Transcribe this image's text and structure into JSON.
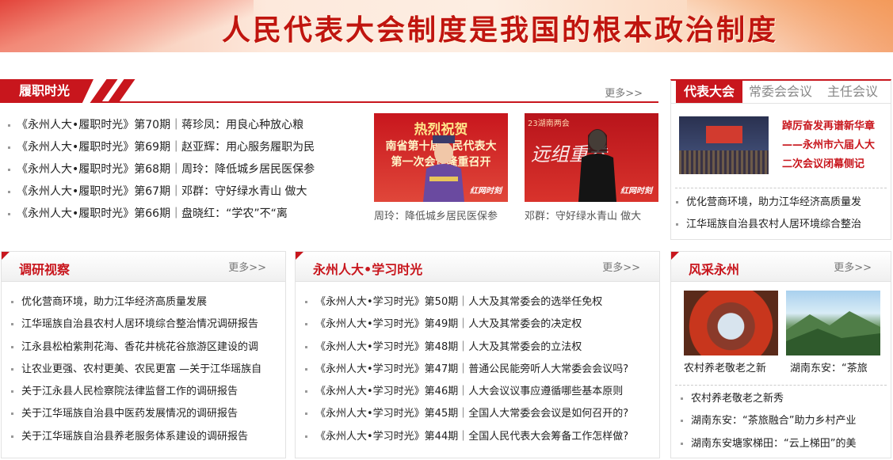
{
  "banner": {
    "title": "人民代表大会制度是我国的根本政治制度"
  },
  "lvzhi": {
    "title": "履职时光",
    "more": "更多>>",
    "items": [
      "《永州人大•履职时光》第70期｜蒋珍凤：用良心种放心粮",
      "《永州人大•履职时光》第69期｜赵亚辉：用心服务履职为民",
      "《永州人大•履职时光》第68期｜周玲：降低城乡居民医保参",
      "《永州人大•履职时光》第67期｜邓群：守好绿水青山 做大",
      "《永州人大•履职时光》第66期｜盘晓红：“学农”不“离"
    ],
    "photos": [
      {
        "caption": "周玲：降低城乡居民医保参",
        "overlay1": "热烈祝贺",
        "overlay2": "南省第十届人民代表大",
        "overlay3": "第一次会议隆重召开",
        "stamp": "红网时刻"
      },
      {
        "caption": "邓群：守好绿水青山 做大",
        "overlay1": "23湖南两会",
        "overlay2": "远组重卷",
        "stamp": "红网时刻"
      }
    ]
  },
  "daibiao": {
    "tabs": [
      "代表大会",
      "常委会会议",
      "主任会议"
    ],
    "feature_title": "踔厉奋发再谱新华章——永州市六届人大二次会议闭幕侧记",
    "items": [
      "优化营商环境，助力江华经济高质量发",
      "江华瑶族自治县农村人居环境综合整治"
    ]
  },
  "diaoyan": {
    "title": "调研视察",
    "more": "更多>>",
    "items": [
      "优化营商环境，助力江华经济高质量发展",
      "江华瑶族自治县农村人居环境综合整治情况调研报告",
      "江永县松柏紫荆花海、香花井桃花谷旅游区建设的调",
      "让农业更强、农村更美、农民更富 —关于江华瑶族自",
      "关于江永县人民检察院法律监督工作的调研报告",
      "关于江华瑶族自治县中医药发展情况的调研报告",
      "关于江华瑶族自治县养老服务体系建设的调研报告"
    ]
  },
  "xuexi": {
    "title": "永州人大•学习时光",
    "more": "更多>>",
    "items": [
      "《永州人大•学习时光》第50期｜人大及其常委会的选举任免权",
      "《永州人大•学习时光》第49期｜人大及其常委会的决定权",
      "《永州人大•学习时光》第48期｜人大及其常委会的立法权",
      "《永州人大•学习时光》第47期｜普通公民能旁听人大常委会会议吗?",
      "《永州人大•学习时光》第46期｜人大会议议事应遵循哪些基本原则",
      "《永州人大•学习时光》第45期｜全国人大常委会会议是如何召开的?",
      "《永州人大•学习时光》第44期｜全国人民代表大会筹备工作怎样做?"
    ]
  },
  "fengcai": {
    "title": "风采永州",
    "more": "更多>>",
    "photos": [
      {
        "caption": "农村养老敬老之新"
      },
      {
        "caption": "湖南东安：“茶旅"
      }
    ],
    "items": [
      "农村养老敬老之新秀",
      "湖南东安：“茶旅融合”助力乡村产业",
      "湖南东安塘家梯田：“云上梯田”的美"
    ]
  }
}
